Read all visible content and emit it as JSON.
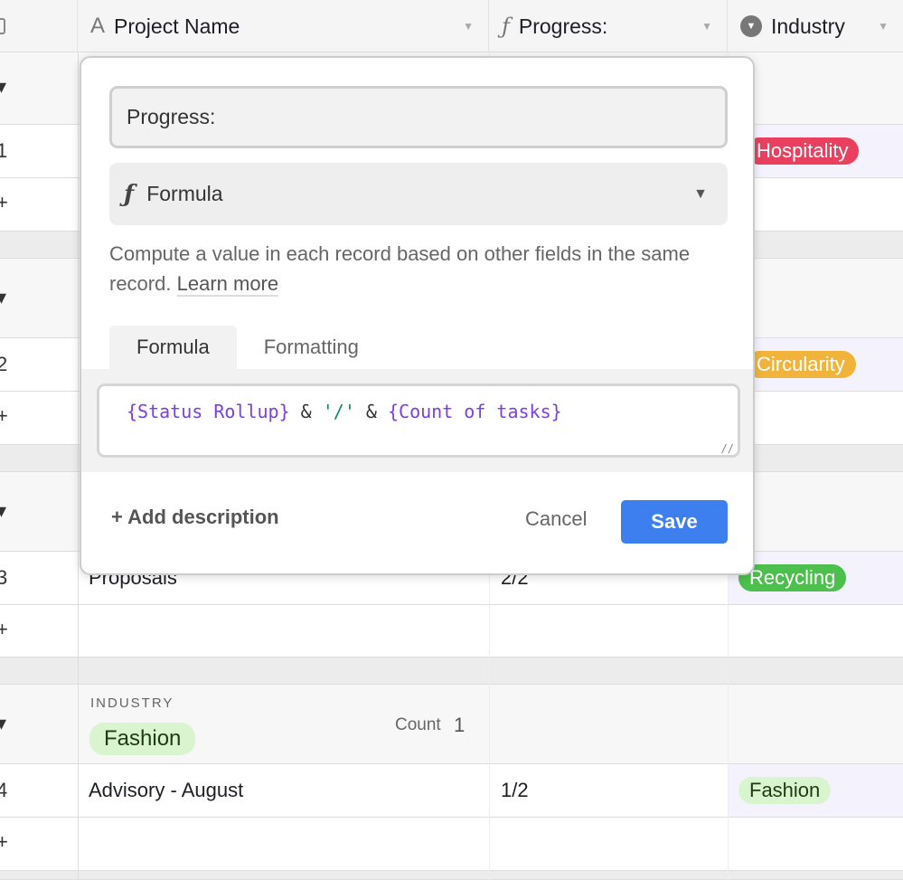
{
  "columns": [
    {
      "label": "Project Name",
      "icon": "text-icon"
    },
    {
      "label": "Progress:",
      "icon": "formula-icon"
    },
    {
      "label": "Industry",
      "icon": "single-select-icon"
    }
  ],
  "rows": [
    {
      "num": "1",
      "name": "",
      "progress": "",
      "industry": "Hospitality",
      "color": "#e8405e",
      "text": "#fff"
    },
    {
      "num": "2",
      "name": "",
      "progress": "",
      "industry": "Circularity",
      "color": "#f2b33a",
      "text": "#fff"
    },
    {
      "num": "3",
      "name": "Proposals",
      "progress": "2/2",
      "industry": "Recycling",
      "color": "#4cbf4c",
      "text": "#fff"
    },
    {
      "num": "4",
      "name": "Advisory - August",
      "progress": "1/2",
      "industry": "Fashion",
      "color": "#d9f5cf",
      "text": "#1d3a12"
    }
  ],
  "group": {
    "label": "INDUSTRY",
    "value": "Fashion",
    "count_label": "Count",
    "count": "1"
  },
  "dialog": {
    "field_name": "Progress:",
    "type": "Formula",
    "description": "Compute a value in each record based on other fields in the same record.",
    "learn_more": "Learn more",
    "tabs": [
      "Formula",
      "Formatting"
    ],
    "formula": {
      "f1": "{Status Rollup}",
      "op1": " & ",
      "s": "'/'",
      "op2": " & ",
      "f2": "{Count of tasks}"
    },
    "add_description": "Add description",
    "cancel": "Cancel",
    "save": "Save",
    "save_color": "#3e7ff0"
  }
}
